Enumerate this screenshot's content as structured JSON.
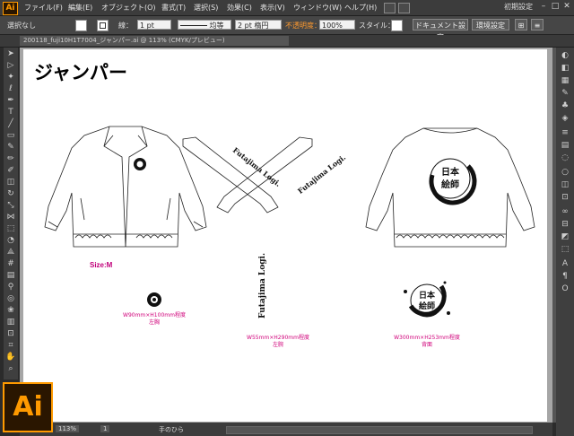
{
  "menubar": {
    "app_logo": "Ai",
    "items": [
      "ファイル(F)",
      "編集(E)",
      "オブジェクト(O)",
      "書式(T)",
      "選択(S)",
      "効果(C)",
      "表示(V)",
      "ウィンドウ(W)",
      "ヘルプ(H)"
    ],
    "workspace": "初期設定",
    "window_buttons": [
      "–",
      "□",
      "✕"
    ]
  },
  "controlbar": {
    "selection": "選択なし",
    "stroke_label": "線：",
    "stroke_weight": "1 pt",
    "profile": "均等",
    "brush": "2 pt 楕円",
    "opacity_label": "不透明度：",
    "opacity": "100%",
    "style_label": "スタイル：",
    "doc_settings": "ドキュメント設定",
    "preferences": "環境設定"
  },
  "document": {
    "tab_title": "200118_fuji10H1T7004_ジャンパー.ai @ 113% (CMYK/プレビュー)"
  },
  "artboard": {
    "title": "ジャンパー",
    "size_label": "Size:M",
    "logo_text_sleeve": "Futajima Logi.",
    "logo_text_back": "Futajima Logi.",
    "vertical_logo_text": "Futajima Logi.",
    "captions": [
      {
        "line1": "W90mm×H100mm程度",
        "line2": "左胸"
      },
      {
        "line1": "W55mm×H290mm程度",
        "line2": "左腕"
      },
      {
        "line1": "W300mm×H253mm程度",
        "line2": "背面"
      }
    ]
  },
  "statusbar": {
    "zoom": "113%",
    "page": "1",
    "tool": "手のひら"
  },
  "icons": {
    "tools": [
      "selection-tool-icon",
      "direct-selection-icon",
      "magic-wand-icon",
      "lasso-icon",
      "pen-icon",
      "type-icon",
      "line-icon",
      "rectangle-icon",
      "paintbrush-icon",
      "pencil-icon",
      "blob-brush-icon",
      "eraser-icon",
      "rotate-icon",
      "scale-icon",
      "width-icon",
      "free-transform-icon",
      "shape-builder-icon",
      "perspective-icon",
      "mesh-icon",
      "gradient-icon",
      "eyedropper-icon",
      "blend-icon",
      "symbol-sprayer-icon",
      "column-graph-icon",
      "artboard-tool-icon",
      "slice-icon",
      "hand-icon",
      "zoom-icon"
    ],
    "panels": [
      "color-panel-icon",
      "color-guide-icon",
      "swatches-icon",
      "brushes-icon",
      "symbols-icon",
      "graphic-styles-icon",
      "stroke-panel-icon",
      "gradient-panel-icon",
      "transparency-icon",
      "appearance-icon",
      "layers-icon",
      "artboards-panel-icon",
      "links-icon",
      "align-icon",
      "pathfinder-icon",
      "transform-icon",
      "character-icon",
      "paragraph-icon",
      "opentype-icon"
    ]
  }
}
